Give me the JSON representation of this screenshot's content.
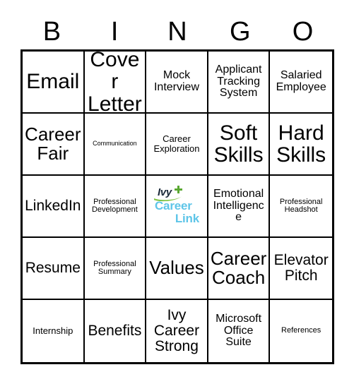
{
  "card": {
    "title": "BINGO",
    "header_letters": [
      "B",
      "I",
      "N",
      "G",
      "O"
    ],
    "colors": {
      "border": "#000000",
      "background": "#ffffff",
      "text": "#000000",
      "logo_ivy": "#1b2a3a",
      "logo_plus_green": "#5aa832",
      "logo_swoosh_green": "#7ec242",
      "logo_career_blue": "#5ec5e8"
    },
    "free_space": {
      "position": "row3-col3",
      "logo_name": "ivy-career-link-logo",
      "logo_line1": "Ivy",
      "logo_line2": "Career",
      "logo_line3": "Link"
    },
    "rows": [
      [
        {
          "label": "Email",
          "size": "t-xxl"
        },
        {
          "label": "Cover\nLetter",
          "size": "t-xxl"
        },
        {
          "label": "Mock\nInterview",
          "size": "t-md"
        },
        {
          "label": "Applicant\nTracking\nSystem",
          "size": "t-md"
        },
        {
          "label": "Salaried\nEmployee",
          "size": "t-md"
        }
      ],
      [
        {
          "label": "Career\nFair",
          "size": "t-xl"
        },
        {
          "label": "Communication",
          "size": "t-xxs"
        },
        {
          "label": "Career\nExploration",
          "size": "t-sm"
        },
        {
          "label": "Soft\nSkills",
          "size": "t-xxl"
        },
        {
          "label": "Hard\nSkills",
          "size": "t-xxl"
        }
      ],
      [
        {
          "label": "LinkedIn",
          "size": "t-lg"
        },
        {
          "label": "Professional\nDevelopment",
          "size": "t-xs"
        },
        {
          "label": "",
          "size": "free"
        },
        {
          "label": "Emotional\nIntelligence",
          "size": "t-md"
        },
        {
          "label": "Professional\nHeadshot",
          "size": "t-xs"
        }
      ],
      [
        {
          "label": "Resume",
          "size": "t-lg"
        },
        {
          "label": "Professional\nSummary",
          "size": "t-xs"
        },
        {
          "label": "Values",
          "size": "t-xl"
        },
        {
          "label": "Career\nCoach",
          "size": "t-xl"
        },
        {
          "label": "Elevator\nPitch",
          "size": "t-lg"
        }
      ],
      [
        {
          "label": "Internship",
          "size": "t-sm"
        },
        {
          "label": "Benefits",
          "size": "t-lg"
        },
        {
          "label": "Ivy\nCareer\nStrong",
          "size": "t-lg"
        },
        {
          "label": "Microsoft\nOffice\nSuite",
          "size": "t-md"
        },
        {
          "label": "References",
          "size": "t-xs"
        }
      ]
    ]
  }
}
